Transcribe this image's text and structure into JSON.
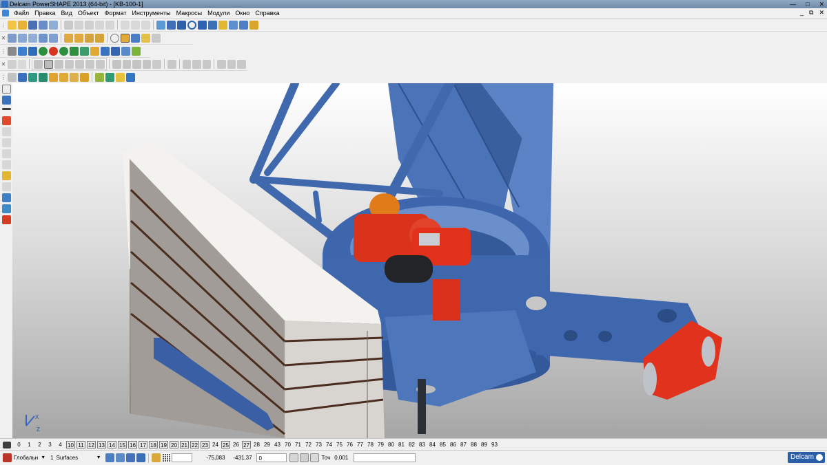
{
  "window": {
    "title": "Delcam PowerSHAPE 2013 (64-bit) - [KB-100-1]",
    "min_icon": "minimize-icon",
    "max_icon": "maximize-icon",
    "close_icon": "close-icon"
  },
  "menu": {
    "items": [
      "Файл",
      "Правка",
      "Вид",
      "Объект",
      "Формат",
      "Инструменты",
      "Макросы",
      "Модули",
      "Окно",
      "Справка"
    ]
  },
  "level_bar": {
    "levels": [
      {
        "label": "0",
        "boxed": false
      },
      {
        "label": "1",
        "boxed": false
      },
      {
        "label": "2",
        "boxed": false
      },
      {
        "label": "3",
        "boxed": false
      },
      {
        "label": "4",
        "boxed": false
      },
      {
        "label": "10",
        "boxed": true
      },
      {
        "label": "11",
        "boxed": true
      },
      {
        "label": "12",
        "boxed": true
      },
      {
        "label": "13",
        "boxed": true
      },
      {
        "label": "14",
        "boxed": true
      },
      {
        "label": "15",
        "boxed": true
      },
      {
        "label": "16",
        "boxed": true
      },
      {
        "label": "17",
        "boxed": true
      },
      {
        "label": "18",
        "boxed": true
      },
      {
        "label": "19",
        "boxed": true
      },
      {
        "label": "20",
        "boxed": true
      },
      {
        "label": "21",
        "boxed": true
      },
      {
        "label": "22",
        "boxed": true
      },
      {
        "label": "23",
        "boxed": true
      },
      {
        "label": "24",
        "boxed": false
      },
      {
        "label": "25",
        "boxed": true
      },
      {
        "label": "26",
        "boxed": false
      },
      {
        "label": "27",
        "boxed": true
      },
      {
        "label": "28",
        "boxed": false
      },
      {
        "label": "29",
        "boxed": false
      },
      {
        "label": "43",
        "boxed": false
      },
      {
        "label": "70",
        "boxed": false
      },
      {
        "label": "71",
        "boxed": false
      },
      {
        "label": "72",
        "boxed": false
      },
      {
        "label": "73",
        "boxed": false
      },
      {
        "label": "74",
        "boxed": false
      },
      {
        "label": "75",
        "boxed": false
      },
      {
        "label": "76",
        "boxed": false
      },
      {
        "label": "77",
        "boxed": false
      },
      {
        "label": "78",
        "boxed": false
      },
      {
        "label": "79",
        "boxed": false
      },
      {
        "label": "80",
        "boxed": false
      },
      {
        "label": "81",
        "boxed": false
      },
      {
        "label": "82",
        "boxed": false
      },
      {
        "label": "83",
        "boxed": false
      },
      {
        "label": "84",
        "boxed": false
      },
      {
        "label": "85",
        "boxed": false
      },
      {
        "label": "86",
        "boxed": false
      },
      {
        "label": "87",
        "boxed": false
      },
      {
        "label": "88",
        "boxed": false
      },
      {
        "label": "89",
        "boxed": false
      },
      {
        "label": "93",
        "boxed": false
      }
    ]
  },
  "status": {
    "workplane": "Глобальн",
    "level_number": "1",
    "level_name": "Surfaces",
    "x_coord": "-75,083",
    "y_coord": "-431,37",
    "z_coord": "0",
    "tolerance_label": "Точ",
    "tolerance_value": "0,001",
    "brand": "Delcam"
  },
  "viewport": {
    "axis_x": "X",
    "axis_z": "Z"
  },
  "colors": {
    "steel_blue": "#3d64a8",
    "motor_red": "#e0301a",
    "counterweight": "#e9e6e2",
    "stripe": "#4a2d1e"
  }
}
